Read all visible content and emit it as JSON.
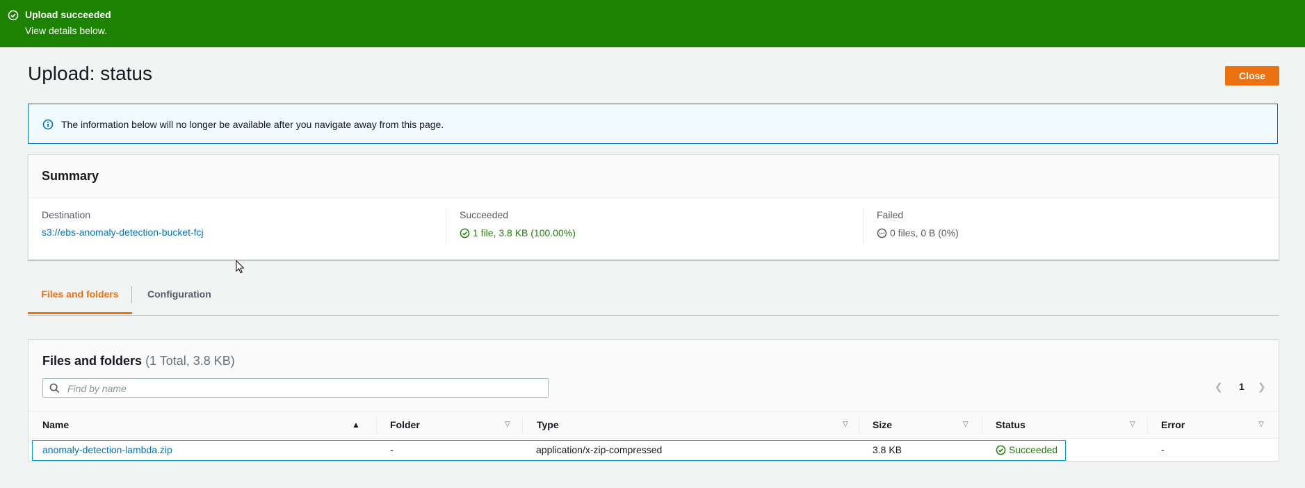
{
  "flash": {
    "title": "Upload succeeded",
    "subtitle": "View details below.",
    "icon": "success-circle-icon",
    "color": "#1d8102"
  },
  "page": {
    "title": "Upload: status",
    "close_label": "Close"
  },
  "info": {
    "icon": "info-icon",
    "text": "The information below will no longer be available after you navigate away from this page."
  },
  "summary": {
    "title": "Summary",
    "destination_label": "Destination",
    "destination_value": "s3://ebs-anomaly-detection-bucket-fcj",
    "succeeded_label": "Succeeded",
    "succeeded_value": "1 file, 3.8 KB (100.00%)",
    "failed_label": "Failed",
    "failed_value": "0 files, 0 B (0%)"
  },
  "tabs": [
    {
      "label": "Files and folders",
      "active": true
    },
    {
      "label": "Configuration",
      "active": false
    }
  ],
  "files": {
    "title": "Files and folders",
    "count": "(1 Total, 3.8 KB)",
    "search_placeholder": "Find by name",
    "page_number": "1",
    "columns": [
      "Name",
      "Folder",
      "Type",
      "Size",
      "Status",
      "Error"
    ],
    "rows": [
      {
        "name": "anomaly-detection-lambda.zip",
        "folder": "-",
        "type": "application/x-zip-compressed",
        "size": "3.8 KB",
        "status": "Succeeded",
        "error": "-"
      }
    ]
  }
}
